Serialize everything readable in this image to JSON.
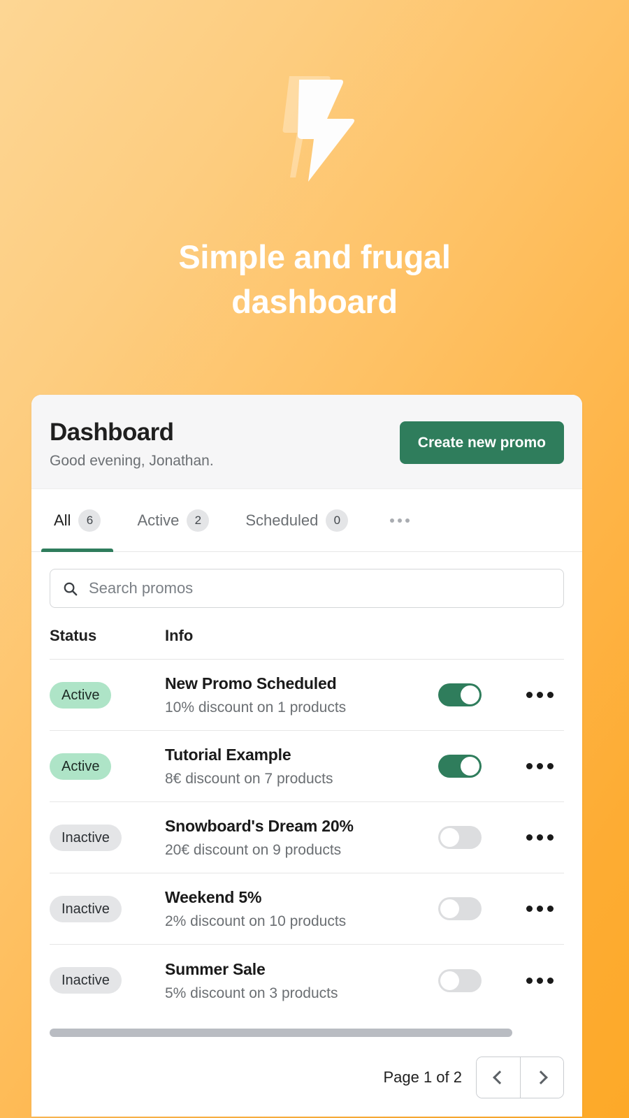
{
  "hero": {
    "logo_icon": "lightning-bolt-icon",
    "headline_line1": "Simple and frugal",
    "headline_line2": "dashboard"
  },
  "card": {
    "header": {
      "title": "Dashboard",
      "greeting": "Good evening, Jonathan.",
      "primary_button": "Create new promo"
    },
    "tabs": [
      {
        "label": "All",
        "count": "6",
        "active": true
      },
      {
        "label": "Active",
        "count": "2",
        "active": false
      },
      {
        "label": "Scheduled",
        "count": "0",
        "active": false
      }
    ],
    "tabs_overflow_icon": "ellipsis-icon",
    "search": {
      "icon": "search-icon",
      "placeholder": "Search promos",
      "value": ""
    },
    "table": {
      "columns": [
        "Status",
        "Info"
      ],
      "rows": [
        {
          "status": "Active",
          "status_type": "active",
          "name": "New Promo Scheduled",
          "detail": "10% discount on 1 products",
          "toggle_on": true,
          "actions_icon": "ellipsis-icon"
        },
        {
          "status": "Active",
          "status_type": "active",
          "name": "Tutorial Example",
          "detail": "8€ discount on 7 products",
          "toggle_on": true,
          "actions_icon": "ellipsis-icon"
        },
        {
          "status": "Inactive",
          "status_type": "inactive",
          "name": "Snowboard's Dream 20%",
          "detail": "20€ discount on 9 products",
          "toggle_on": false,
          "actions_icon": "ellipsis-icon"
        },
        {
          "status": "Inactive",
          "status_type": "inactive",
          "name": "Weekend 5%",
          "detail": "2% discount on 10 products",
          "toggle_on": false,
          "actions_icon": "ellipsis-icon"
        },
        {
          "status": "Inactive",
          "status_type": "inactive",
          "name": "Summer Sale",
          "detail": "5% discount on 3 products",
          "toggle_on": false,
          "actions_icon": "ellipsis-icon"
        }
      ]
    },
    "pagination": {
      "label": "Page 1 of 2",
      "prev_icon": "chevron-left-icon",
      "next_icon": "chevron-right-icon"
    }
  },
  "colors": {
    "brand_green": "#2f7d5c",
    "badge_active_bg": "#aee4c7",
    "badge_inactive_bg": "#e4e5e7",
    "bg_gradient_start": "#fdd694",
    "bg_gradient_end": "#fda928",
    "card_header_bg": "#f6f6f7"
  }
}
